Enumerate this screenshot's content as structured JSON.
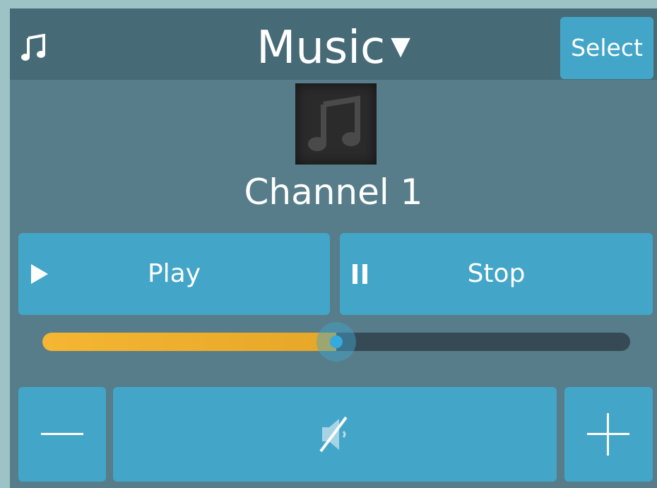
{
  "header": {
    "icon": "music-note-icon",
    "title": "Music",
    "caret": "▼",
    "select_label": "Select"
  },
  "now_playing": {
    "album_art_icon": "music-note-icon",
    "channel_name": "Channel 1"
  },
  "transport": {
    "play_label": "Play",
    "play_icon": "play-icon",
    "stop_label": "Stop",
    "stop_icon": "pause-icon"
  },
  "progress": {
    "value_fraction": 0.5
  },
  "volume": {
    "minus_icon": "minus-icon",
    "mute_icon": "speaker-muted-icon",
    "plus_icon": "plus-icon"
  },
  "colors": {
    "panel": "#567d89",
    "header": "#466b77",
    "button": "#43a6c8",
    "progress_fill": "#f5b633",
    "track": "#364a55",
    "thumb": "#36a9dd"
  }
}
